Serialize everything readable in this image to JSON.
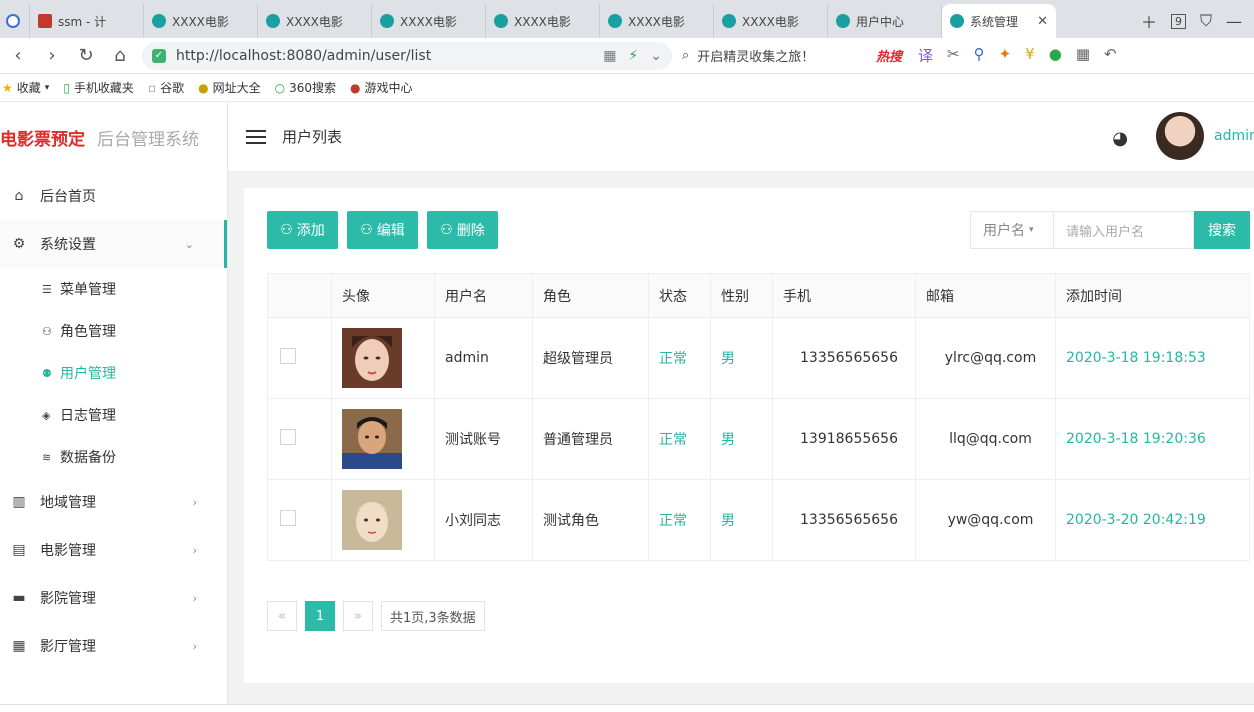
{
  "browser": {
    "tabs": [
      {
        "label": "ssm - 计"
      },
      {
        "label": "XXXX电影"
      },
      {
        "label": "XXXX电影"
      },
      {
        "label": "XXXX电影"
      },
      {
        "label": "XXXX电影"
      },
      {
        "label": "XXXX电影"
      },
      {
        "label": "XXXX电影"
      },
      {
        "label": "用户中心"
      },
      {
        "label": "系统管理"
      }
    ],
    "tab_count": "9",
    "url": "http://localhost:8080/admin/user/list",
    "search_text": "开启精灵收集之旅！",
    "hot_label": "热搜",
    "bookmarks": [
      "收藏",
      "手机收藏夹",
      "谷歌",
      "网址大全",
      "360搜索",
      "游戏中心"
    ]
  },
  "app": {
    "brand_title": "电影票预定",
    "brand_subtitle": "后台管理系统",
    "page_title": "用户列表",
    "user_name": "admin",
    "menu": {
      "home": "后台首页",
      "settings": "系统设置",
      "sub": [
        "菜单管理",
        "角色管理",
        "用户管理",
        "日志管理",
        "数据备份"
      ],
      "region": "地域管理",
      "movie": "电影管理",
      "cinema": "影院管理",
      "hall": "影厅管理"
    },
    "actions": {
      "add": "添加",
      "edit": "编辑",
      "delete": "删除"
    },
    "search": {
      "field": "用户名",
      "placeholder": "请输入用户名",
      "button": "搜索"
    },
    "table": {
      "headers": [
        "头像",
        "用户名",
        "角色",
        "状态",
        "性别",
        "手机",
        "邮箱",
        "添加时间"
      ],
      "rows": [
        {
          "username": "admin",
          "role": "超级管理员",
          "status": "正常",
          "gender": "男",
          "phone": "13356565656",
          "email": "ylrc@qq.com",
          "created": "2020-3-18 19:18:53"
        },
        {
          "username": "测试账号",
          "role": "普通管理员",
          "status": "正常",
          "gender": "男",
          "phone": "13918655656",
          "email": "llq@qq.com",
          "created": "2020-3-18 19:20:36"
        },
        {
          "username": "小刘同志",
          "role": "测试角色",
          "status": "正常",
          "gender": "男",
          "phone": "13356565656",
          "email": "yw@qq.com",
          "created": "2020-3-20 20:42:19"
        }
      ]
    },
    "pager": {
      "prev": "«",
      "current": "1",
      "next": "»",
      "info": "共1页,3条数据"
    }
  },
  "colors": {
    "accent": "#2dbba9",
    "brand": "#e02b2b"
  }
}
